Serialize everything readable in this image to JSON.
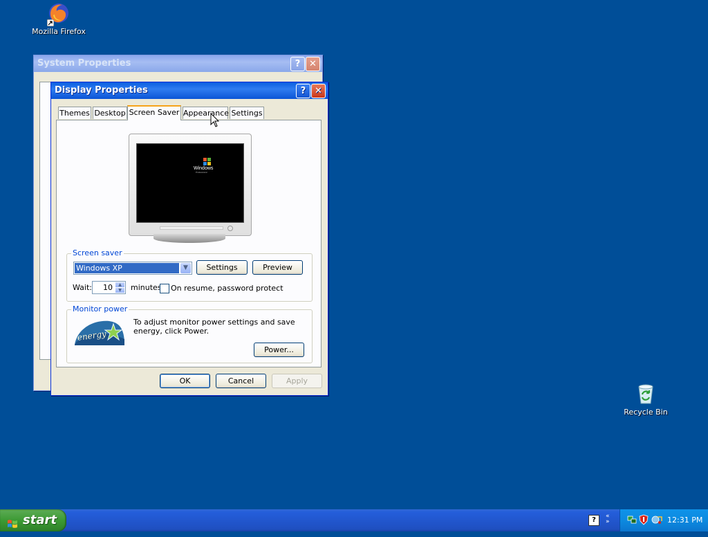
{
  "desktop": {
    "icons": [
      {
        "label": "Mozilla Firefox"
      },
      {
        "label": "Recycle Bin"
      }
    ]
  },
  "system_properties": {
    "title": "System Properties"
  },
  "display_properties": {
    "title": "Display Properties",
    "tabs": [
      {
        "label": "Themes"
      },
      {
        "label": "Desktop"
      },
      {
        "label": "Screen Saver"
      },
      {
        "label": "Appearance"
      },
      {
        "label": "Settings"
      }
    ],
    "active_tab": "Screen Saver",
    "preview_logo_text": "Windows",
    "preview_logo_sub": "Professional",
    "screen_saver": {
      "group_label": "Screen saver",
      "selected": "Windows XP",
      "settings_label": "Settings",
      "preview_label": "Preview",
      "wait_label": "Wait:",
      "wait_value": "10",
      "minutes_label": "minutes",
      "password_protect_label": "On resume, password protect",
      "password_protect_checked": false
    },
    "monitor_power": {
      "group_label": "Monitor power",
      "description": "To adjust monitor power settings and save energy, click Power.",
      "power_label": "Power...",
      "energy_logo_text": "energy"
    },
    "buttons": {
      "ok": "OK",
      "cancel": "Cancel",
      "apply": "Apply"
    }
  },
  "taskbar": {
    "start_label": "start",
    "clock": "12:31 PM"
  },
  "colors": {
    "desktop_bg": "#004e98",
    "titlebar_active": "#0a5fe0",
    "tab_highlight": "#f6a31a",
    "group_label": "#0046d5"
  }
}
